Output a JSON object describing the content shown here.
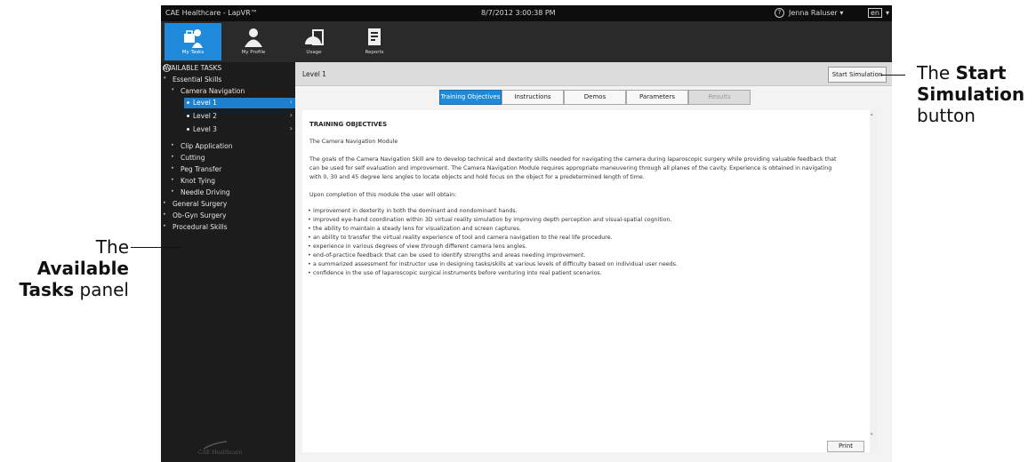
{
  "titlebar": {
    "app_title": "CAE Healthcare - LapVR™",
    "datetime": "8/7/2012 3:00:38 PM",
    "help_icon": "help-circle-icon",
    "user": "Jenna Raluser",
    "language": "en"
  },
  "toolbar": {
    "items": [
      {
        "label": "My Tasks",
        "icon": "tasks-icon",
        "active": true
      },
      {
        "label": "My Profile",
        "icon": "profile-icon"
      },
      {
        "label": "Usage",
        "icon": "usage-icon"
      },
      {
        "label": "Reports",
        "icon": "reports-icon"
      }
    ]
  },
  "sidebar": {
    "heading": "AVAILABLE TASKS",
    "tree": [
      {
        "label": "Essential Skills"
      },
      {
        "label": "Camera Navigation"
      },
      {
        "label": "Level 1"
      },
      {
        "label": "Level 2"
      },
      {
        "label": "Level 3"
      },
      {
        "label": "Clip Application"
      },
      {
        "label": "Cutting"
      },
      {
        "label": "Peg Transfer"
      },
      {
        "label": "Knot Tying"
      },
      {
        "label": "Needle Driving"
      },
      {
        "label": "General Surgery"
      },
      {
        "label": "Ob-Gyn Surgery"
      },
      {
        "label": "Procedural Skills"
      }
    ],
    "logo": "CAE Healthcare"
  },
  "main": {
    "level_title": "Level 1",
    "start_button": "Start Simulation",
    "tabs": [
      "Training Objectives",
      "Instructions",
      "Demos",
      "Parameters",
      "Results"
    ],
    "heading": "TRAINING OBJECTIVES",
    "module_name": "The Camera Navigation Module",
    "paragraph_lines": [
      "The goals of the Camera Navigation Skill are to develop technical and dexterity skills needed for navigating the camera during laparoscopic surgery while providing valuable feedback that",
      "can be used for self evaluation and improvement. The Camera Navigation Module requires appropriate maneuvering through all planes of the cavity. Experience is obtained in navigating",
      "with 0, 30 and 45 degree lens angles to locate objects and hold focus on the object for a predetermined length of time."
    ],
    "upon": "Upon completion of this module the user will obtain:",
    "bullets": [
      "improvement in dexterity in both the dominant and nondominant hands.",
      "improved eye-hand coordination within 3D virtual reality simulation by improving depth perception and visual-spatial cognition.",
      "the ability to maintain a steady lens for visualization and screen captures.",
      "an ability to transfer the virtual reality experience of tool and camera navigation to the real life procedure.",
      "experience in various degrees of view through different camera lens angles.",
      "end-of-practice feedback that can be used to identify strengths and areas needing improvement.",
      "a summarized assessment for instructor use in designing tasks/skills at various levels of difficulty based on individual user needs.",
      "confidence in the use of laparoscopic surgical instruments before venturing into real patient scenarios."
    ],
    "print_button": "Print"
  },
  "annotations": {
    "start": {
      "the": "The",
      "bold1": "Start",
      "bold2": "Simulation",
      "tail": "button"
    },
    "tasks": {
      "the": "The",
      "bold1": "Available",
      "bold2": "Tasks",
      "tail": "panel"
    }
  }
}
